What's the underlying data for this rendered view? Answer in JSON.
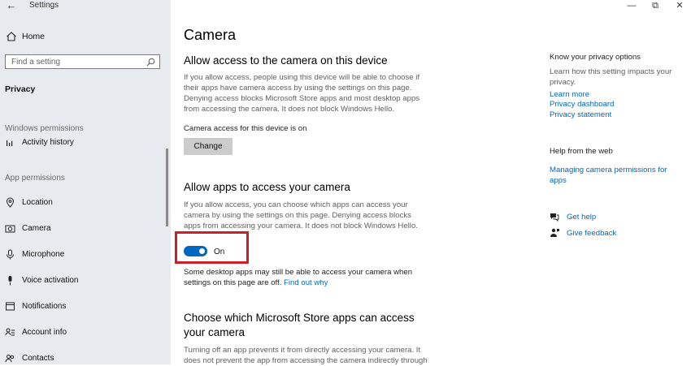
{
  "window": {
    "app_title": "Settings",
    "back_label": "←",
    "minimize": "—",
    "restore": "⧉",
    "close": "✕"
  },
  "sidebar": {
    "home": "Home",
    "search_placeholder": "Find a setting",
    "section": "Privacy",
    "windows_permissions_label": "Windows permissions",
    "activity_history": "Activity history",
    "app_permissions_label": "App permissions",
    "items": [
      {
        "label": "Location",
        "icon": "location-icon"
      },
      {
        "label": "Camera",
        "icon": "camera-icon"
      },
      {
        "label": "Microphone",
        "icon": "microphone-icon"
      },
      {
        "label": "Voice activation",
        "icon": "voice-activation-icon"
      },
      {
        "label": "Notifications",
        "icon": "notifications-icon"
      },
      {
        "label": "Account info",
        "icon": "account-info-icon"
      },
      {
        "label": "Contacts",
        "icon": "contacts-icon"
      }
    ]
  },
  "main": {
    "title": "Camera",
    "device_section": {
      "heading": "Allow access to the camera on this device",
      "description": "If you allow access, people using this device will be able to choose if their apps have camera access by using the settings on this page. Denying access blocks Microsoft Store apps and most desktop apps from accessing the camera. It does not block Windows Hello.",
      "status": "Camera access for this device is on",
      "button": "Change"
    },
    "apps_section": {
      "heading": "Allow apps to access your camera",
      "description": "If you allow access, you can choose which apps can access your camera by using the settings on this page. Denying access blocks apps from accessing your camera. It does not block Windows Hello.",
      "toggle_state": "On",
      "toggle_on": true,
      "note": "Some desktop apps may still be able to access your camera when settings on this page are off.",
      "note_link": "Find out why"
    },
    "store_section": {
      "heading": "Choose which Microsoft Store apps can access your camera",
      "description": "Turning off an app prevents it from directly accessing your camera. It does not prevent the app from accessing the camera indirectly through"
    }
  },
  "right": {
    "privacy_heading": "Know your privacy options",
    "privacy_text": "Learn how this setting impacts your privacy.",
    "links": [
      "Learn more",
      "Privacy dashboard",
      "Privacy statement"
    ],
    "web_heading": "Help from the web",
    "web_link": "Managing camera permissions for apps",
    "get_help": "Get help",
    "give_feedback": "Give feedback"
  },
  "colors": {
    "accent": "#0067c0",
    "link": "#0067b8",
    "highlight_box": "#cf1f26",
    "sidebar_bg": "#e7eaee"
  }
}
